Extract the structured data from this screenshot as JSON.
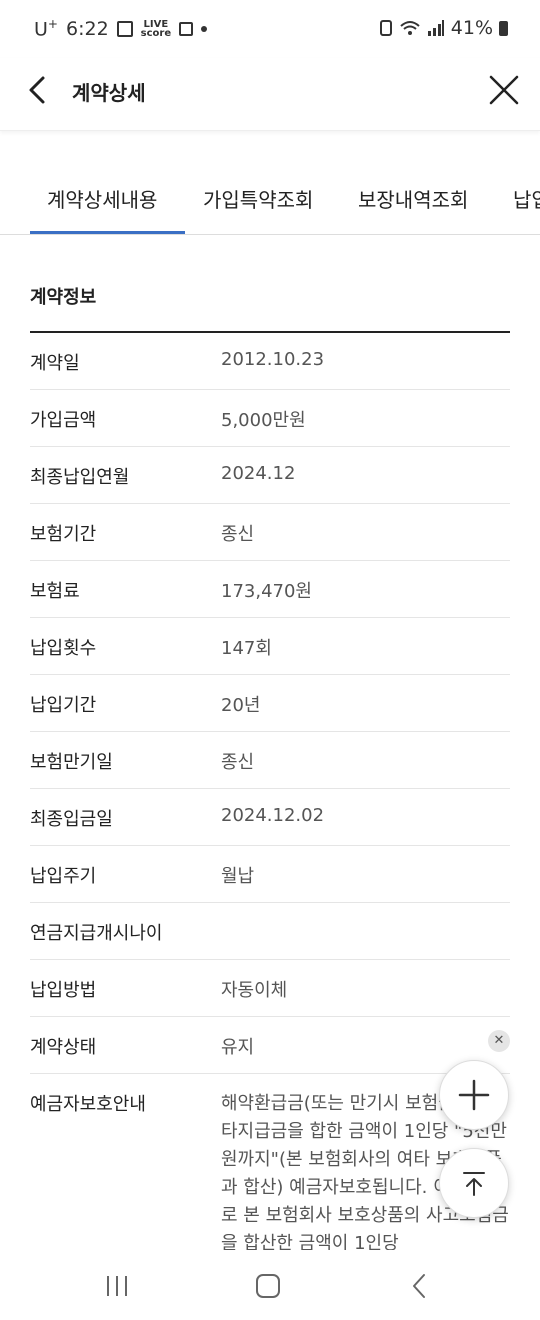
{
  "status_bar": {
    "carrier": "U",
    "carrier_sup": "+",
    "time": "6:22",
    "live_top": "LIVE",
    "live_bottom": "score",
    "battery": "41%"
  },
  "header": {
    "title": "계약상세"
  },
  "tabs": [
    {
      "label": "계약상세내용",
      "active": true
    },
    {
      "label": "가입특약조회",
      "active": false
    },
    {
      "label": "보장내역조회",
      "active": false
    },
    {
      "label": "납입",
      "active": false
    }
  ],
  "section": {
    "title": "계약정보"
  },
  "rows": [
    {
      "label": "계약일",
      "value": "2012.10.23"
    },
    {
      "label": "가입금액",
      "value": "5,000만원"
    },
    {
      "label": "최종납입연월",
      "value": "2024.12"
    },
    {
      "label": "보험기간",
      "value": "종신"
    },
    {
      "label": "보험료",
      "value": "173,470원"
    },
    {
      "label": "납입횟수",
      "value": "147회"
    },
    {
      "label": "납입기간",
      "value": "20년"
    },
    {
      "label": "보험만기일",
      "value": "종신"
    },
    {
      "label": "최종입금일",
      "value": "2024.12.02"
    },
    {
      "label": "납입주기",
      "value": "월납"
    },
    {
      "label": "연금지급개시나이",
      "value": ""
    },
    {
      "label": "납입방법",
      "value": "자동이체"
    },
    {
      "label": "계약상태",
      "value": "유지"
    }
  ],
  "deposit_info": {
    "label": "예금자보호안내",
    "value": "해약환급금(또는 만기시 보험금)에 기타지급금을 합한 금액이 1인당 \"5천만원까지\"(본 보험회사의 여타 보호상품과 합산) 예금자보호됩니다. 이와 별도로 본 보험회사 보호상품의 사고보험금을 합산한 금액이 1인당"
  },
  "icons": {
    "back": "chevron-left-icon",
    "close": "close-icon",
    "add": "plus-icon",
    "scroll_top": "arrow-up-to-line-icon",
    "dismiss": "small-close-icon",
    "nav_recent": "recent-apps-icon",
    "nav_home": "home-icon",
    "nav_back": "back-icon"
  },
  "colors": {
    "accent": "#3a6fc4"
  }
}
